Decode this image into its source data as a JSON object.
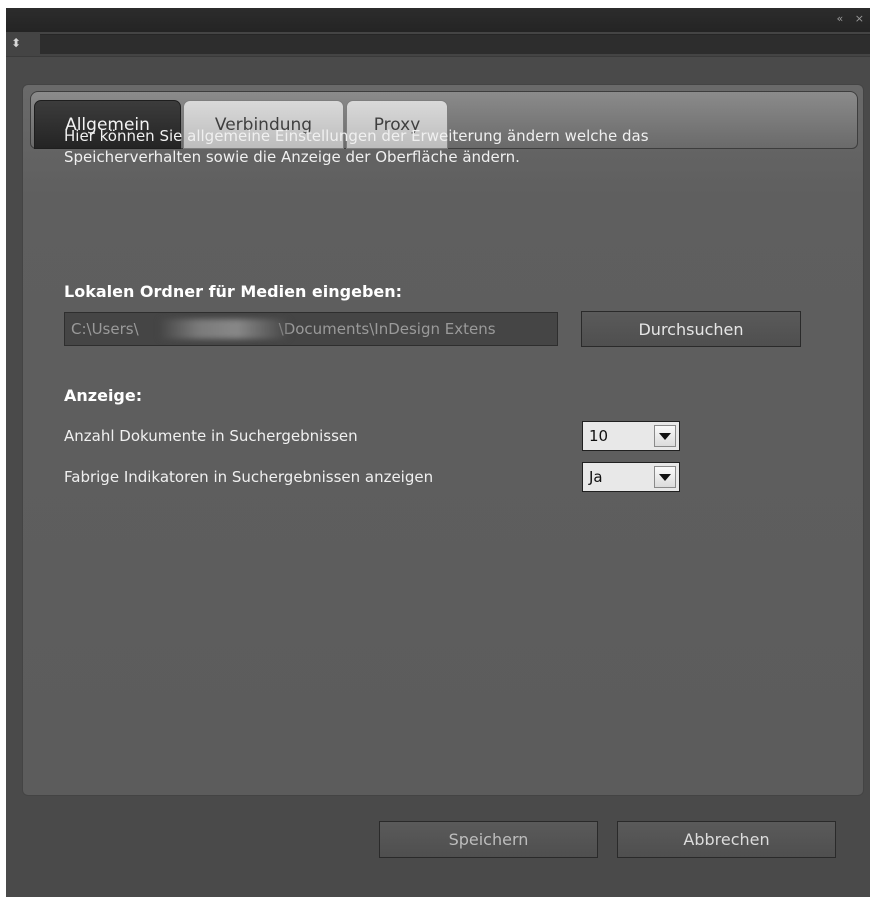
{
  "window": {
    "controls_glyph": "« ×",
    "menu_icon_glyph": "⬍"
  },
  "tabs": [
    {
      "label": "Allgemein",
      "active": true
    },
    {
      "label": "Verbindung",
      "active": false
    },
    {
      "label": "Proxy",
      "active": false
    }
  ],
  "general": {
    "description": "Hier können Sie allgemeine Einstellungen der Erweiterung ändern welche das Speicherverhalten sowie die Anzeige der Oberfläche ändern.",
    "media_folder_label": "Lokalen Ordner für Medien eingeben:",
    "media_folder_value_start": "C:\\Users\\",
    "media_folder_value_end": "\\Documents\\InDesign Extens",
    "browse_button": "Durchsuchen",
    "display_label": "Anzeige:",
    "settings": [
      {
        "label": "Anzahl Dokumente in Suchergebnissen",
        "value": "10"
      },
      {
        "label": "Fabrige Indikatoren in Suchergebnissen anzeigen",
        "value": "Ja"
      }
    ]
  },
  "footer": {
    "save_button": "Speichern",
    "cancel_button": "Abbrechen"
  }
}
